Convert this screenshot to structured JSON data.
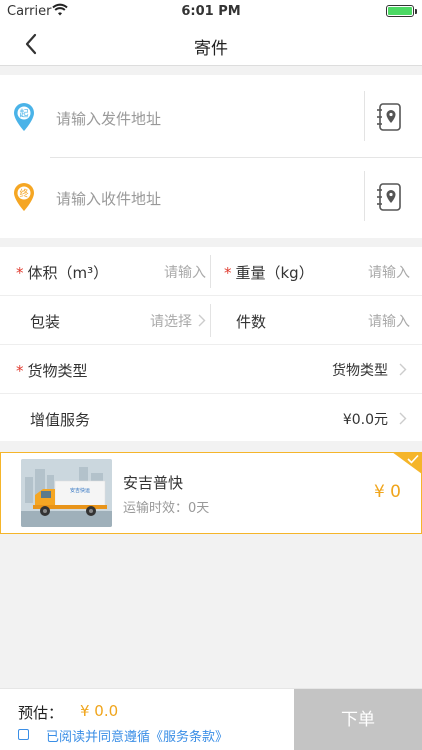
{
  "status_bar": {
    "carrier": "Carrier",
    "time": "6:01 PM"
  },
  "nav": {
    "title": "寄件",
    "back_icon": "chevron-left-icon"
  },
  "address": {
    "sender_placeholder": "请输入发件地址",
    "sender_badge": "起",
    "receiver_placeholder": "请输入收件地址",
    "receiver_badge": "终",
    "sender_color": "#4ab3e8",
    "receiver_color": "#f5a623"
  },
  "form": {
    "volume_label": "体积（m³）",
    "volume_placeholder": "请输入",
    "weight_label": "重量（kg）",
    "weight_placeholder": "请输入",
    "packaging_label": "包装",
    "packaging_placeholder": "请选择",
    "count_label": "件数",
    "count_placeholder": "请输入",
    "goods_type_label": "货物类型",
    "goods_type_value": "货物类型",
    "value_added_label": "增值服务",
    "value_added_value": "¥0.0元",
    "required_mark": "*"
  },
  "carrier_option": {
    "name": "安吉普快",
    "eta": "运输时效：0天",
    "price": "¥ 0",
    "truck_logo_text": "安吉快运",
    "selected": true
  },
  "bottom": {
    "estimate_label": "预估：",
    "estimate_value": "¥ 0.0",
    "terms_text": "已阅读并同意遵循《服务条款》",
    "order_button": "下单"
  },
  "colors": {
    "accent": "#f0a51c",
    "link": "#3a8ee6",
    "required": "#e03b2f",
    "disabled_button": "#c4c4c4"
  }
}
